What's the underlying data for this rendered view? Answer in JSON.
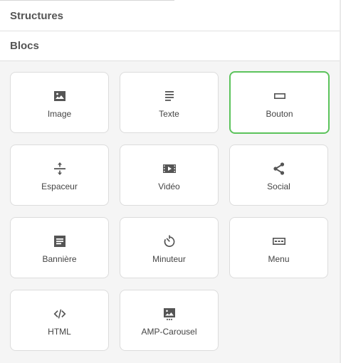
{
  "sections": {
    "structures_label": "Structures",
    "blocs_label": "Blocs"
  },
  "blocks": [
    {
      "label": "Image",
      "icon": "image-icon"
    },
    {
      "label": "Texte",
      "icon": "text-icon"
    },
    {
      "label": "Bouton",
      "icon": "button-icon",
      "selected": true
    },
    {
      "label": "Espaceur",
      "icon": "spacer-icon"
    },
    {
      "label": "Vidéo",
      "icon": "video-icon"
    },
    {
      "label": "Social",
      "icon": "share-icon"
    },
    {
      "label": "Bannière",
      "icon": "banner-icon"
    },
    {
      "label": "Minuteur",
      "icon": "timer-icon"
    },
    {
      "label": "Menu",
      "icon": "menu-icon"
    },
    {
      "label": "HTML",
      "icon": "code-icon"
    },
    {
      "label": "AMP-Carousel",
      "icon": "carousel-icon"
    }
  ],
  "colors": {
    "selected_border": "#5cc35c",
    "icon": "#555555"
  }
}
